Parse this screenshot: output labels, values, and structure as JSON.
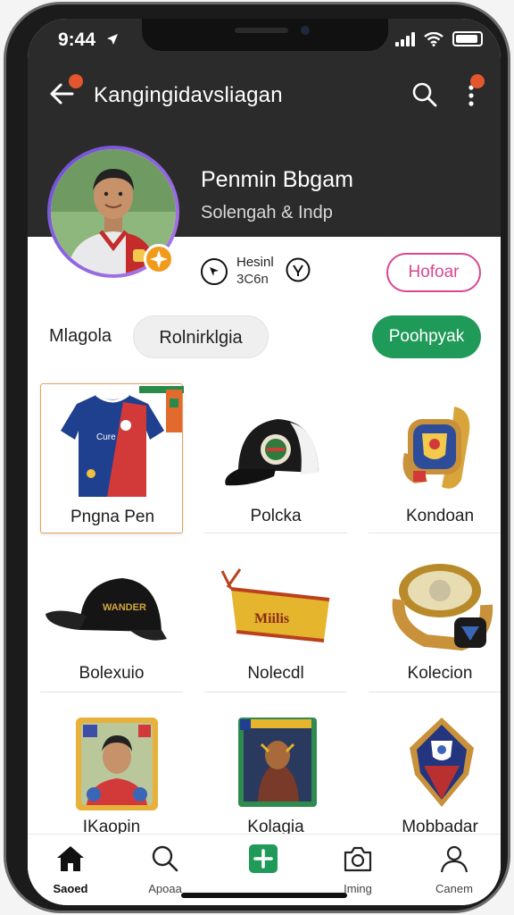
{
  "status_bar": {
    "time": "9:44"
  },
  "app_bar": {
    "title": "Kangingidavsliagan"
  },
  "profile": {
    "name": "Penmin Bbgam",
    "subtitle": "Solengah & Indp",
    "stat_line1": "Hesinl",
    "stat_line2": "3C6n",
    "follow_label": "Hofoar"
  },
  "filters": {
    "all_label": "Mlagola",
    "chip_label": "Rolnirklgia",
    "green_label": "Poohpyak"
  },
  "items": [
    {
      "label": "Pngna Pen",
      "icon": "jersey-icon"
    },
    {
      "label": "Polcka",
      "icon": "cap-icon"
    },
    {
      "label": "Kondoan",
      "icon": "watch-icon"
    },
    {
      "label": "Bolexuio",
      "icon": "cap-black-icon"
    },
    {
      "label": "Nolecdl",
      "icon": "scarf-icon"
    },
    {
      "label": "Kolecion",
      "icon": "ring-icon"
    },
    {
      "label": "IKaopin",
      "icon": "player-card-icon"
    },
    {
      "label": "Kolagia",
      "icon": "character-card-icon"
    },
    {
      "label": "Mobbadar",
      "icon": "badge-icon"
    }
  ],
  "bottom_nav": [
    {
      "label": "Saoed",
      "icon": "home-icon"
    },
    {
      "label": "Apoaa",
      "icon": "search-icon"
    },
    {
      "label": "",
      "icon": "add-icon"
    },
    {
      "label": "Iming",
      "icon": "camera-icon"
    },
    {
      "label": "Canem",
      "icon": "profile-icon"
    }
  ],
  "colors": {
    "header_bg": "#2b2b2b",
    "follow_pink": "#d9468f",
    "green": "#1f9a58",
    "badge_orange": "#e4572e",
    "verified_orange": "#f29a1c"
  }
}
